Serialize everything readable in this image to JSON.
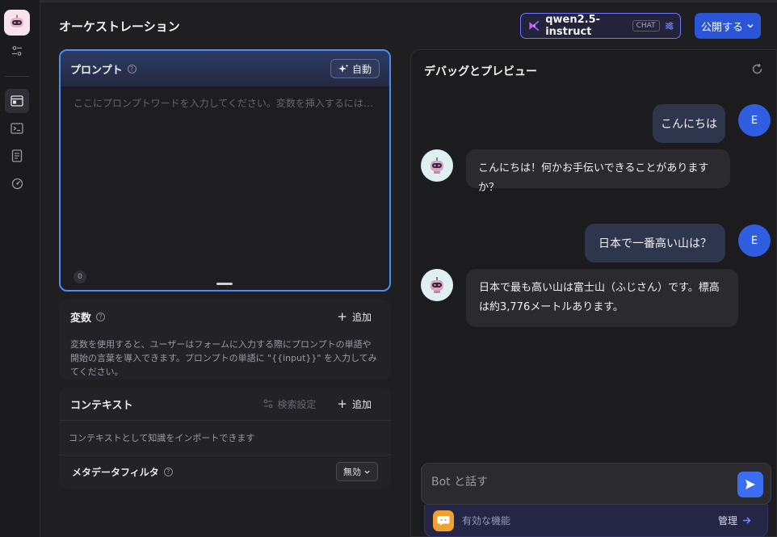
{
  "header": {
    "title": "オーケストレーション",
    "model_name": "qwen2.5-instruct",
    "model_tag": "CHAT",
    "publish_label": "公開する"
  },
  "prompt": {
    "label": "プロンプト",
    "auto_label": "自動",
    "placeholder": "ここにプロンプトワードを入力してください。変数を挿入するには「{」を、プロ...",
    "char_count": "0"
  },
  "variables": {
    "title": "変数",
    "add_label": "追加",
    "description": "変数を使用すると、ユーザーはフォームに入力する際にプロンプトの単語や開始の言葉を導入できます。プロンプトの単語に \"{{input}}\" を入力してみてください。"
  },
  "context": {
    "title": "コンテキスト",
    "retrieval_label": "検索設定",
    "add_label": "追加",
    "description": "コンテキストとして知識をインポートできます",
    "metadata_filter_label": "メタデータフィルタ",
    "metadata_filter_value": "無効"
  },
  "debug": {
    "title": "デバッグとプレビュー",
    "messages": [
      {
        "role": "user",
        "avatar": "E",
        "text": "こんにちは"
      },
      {
        "role": "bot",
        "text": "こんにちは！何かお手伝いできることがありますか？"
      },
      {
        "role": "user",
        "avatar": "E",
        "text": "日本で一番高い山は？"
      },
      {
        "role": "bot",
        "text": "日本で最も高い山は富士山（ふじさん）です。標高は約3,776メートルあります。"
      }
    ],
    "input_placeholder": "Bot と話す",
    "features_label": "有効な機能",
    "manage_label": "管理"
  },
  "colors": {
    "accent": "#2a55d6",
    "prompt_border": "#4b8df5",
    "send": "#3b6ef0",
    "user_avatar": "#2f5ee0"
  }
}
